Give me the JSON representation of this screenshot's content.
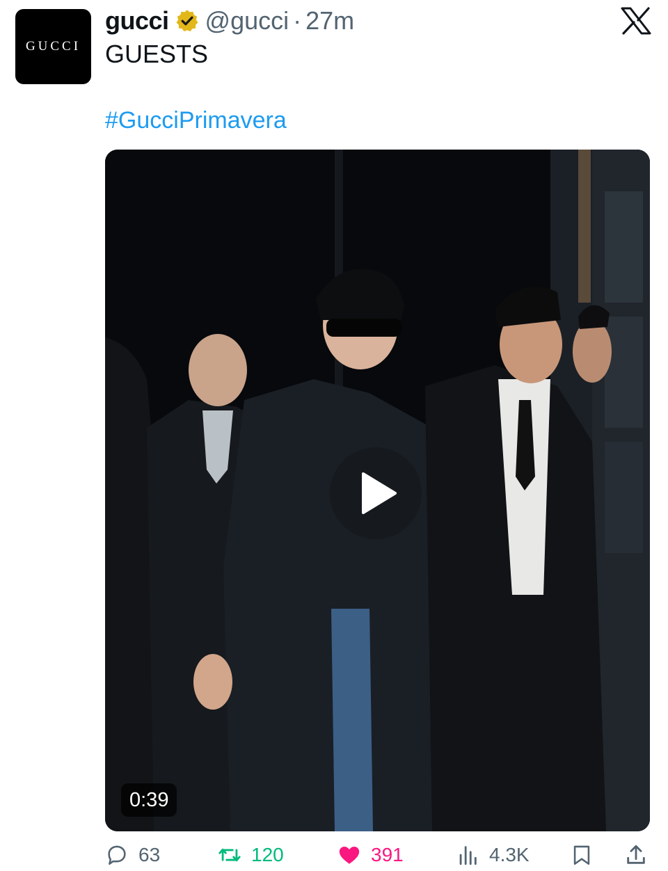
{
  "account": {
    "avatar_text": "GUCCI",
    "display_name": "gucci",
    "handle": "@gucci",
    "separator": "·",
    "time": "27m"
  },
  "post": {
    "text": "GUESTS",
    "hashtag": "#GucciPrimavera"
  },
  "video": {
    "duration": "0:39"
  },
  "actions": {
    "replies": "63",
    "reposts": "120",
    "likes": "391",
    "views": "4.3K"
  },
  "icons": {
    "verified": "gold-verified-badge-icon",
    "platform": "x-logo-icon",
    "play": "play-icon",
    "reply": "reply-bubble-icon",
    "repost": "repost-icon",
    "like": "heart-icon",
    "views": "views-bar-chart-icon",
    "bookmark": "bookmark-icon",
    "share": "share-icon"
  },
  "colors": {
    "hashtag": "#1d9bf0",
    "repost": "#00ba7c",
    "like": "#f91880",
    "verified": "#e2b719",
    "muted": "#536471"
  }
}
